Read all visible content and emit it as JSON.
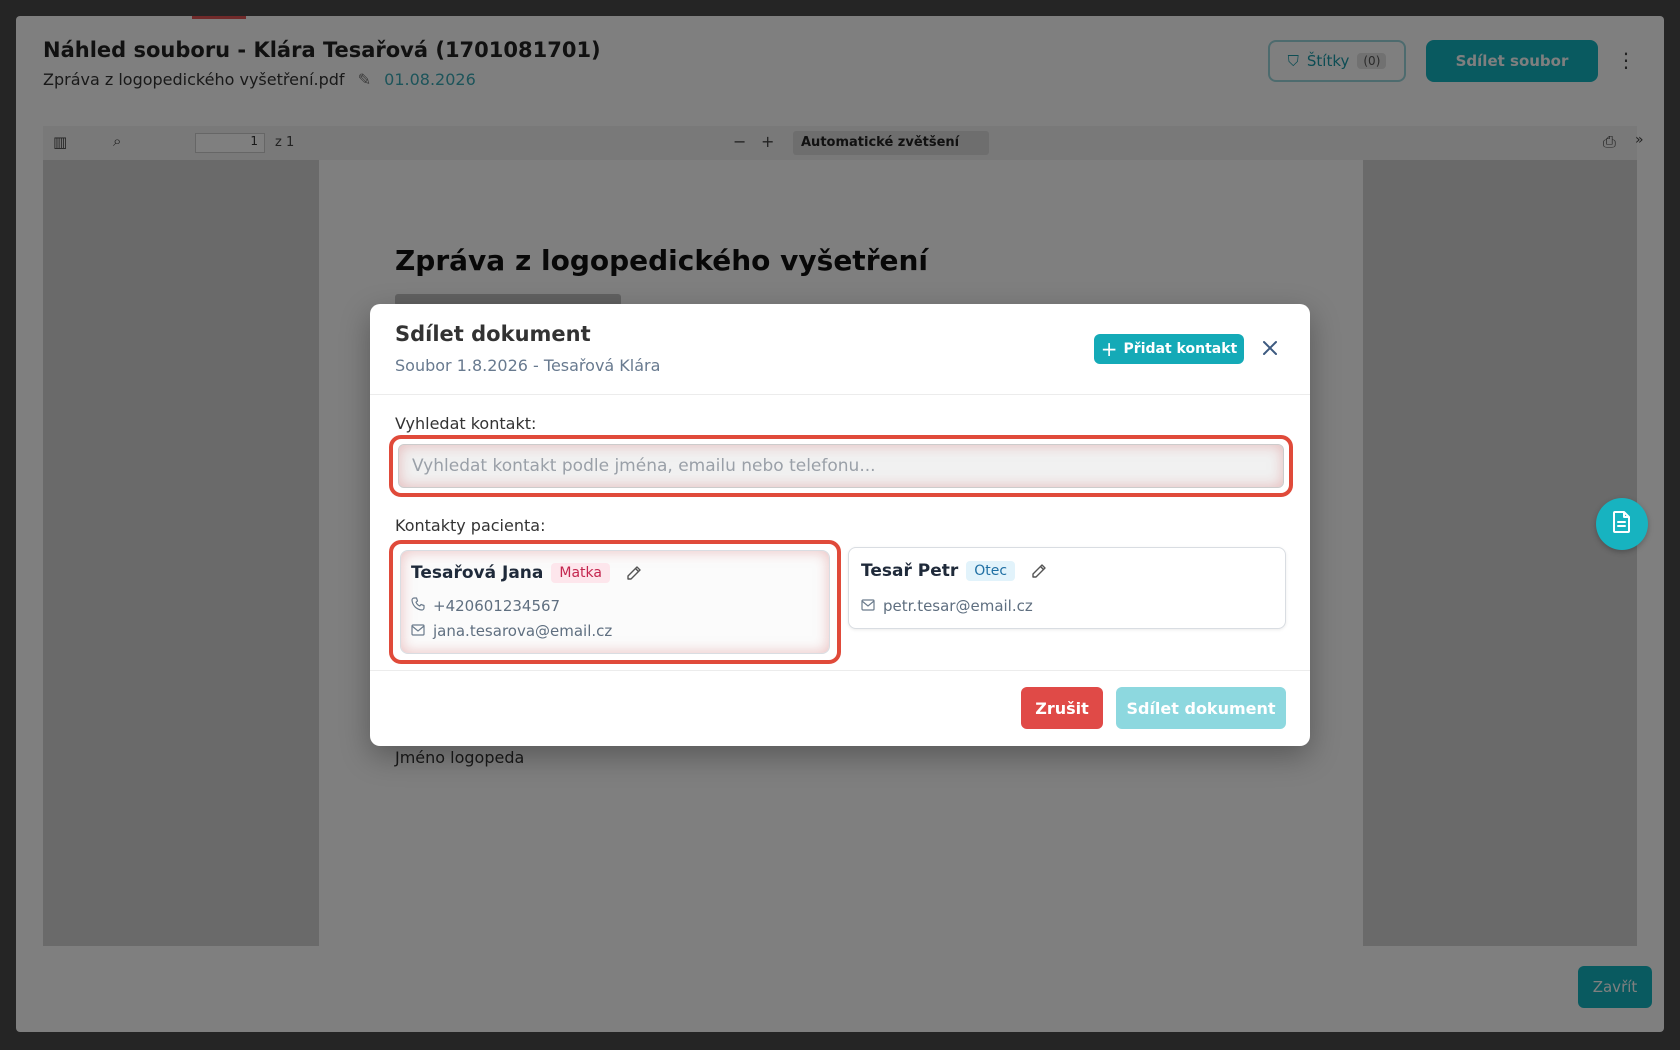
{
  "background": {
    "title": "Náhled souboru - Klára Tesařová (1701081701)",
    "file_name": "Zpráva z logopedického vyšetření.pdf",
    "date": "01.08.2026",
    "filter_label": "Štítky",
    "filter_count": "(0)",
    "share_button": "Sdílet soubor",
    "toolbar": {
      "page_value": "1",
      "pages_label": "z 1",
      "zoom_label": "Automatické zvětšení"
    },
    "document": {
      "heading": "Zpráva z logopedického vyšetření",
      "signature": "Jméno logopeda"
    },
    "close_button": "Zavřít"
  },
  "modal": {
    "title": "Sdílet dokument",
    "subtitle": "Soubor 1.8.2026 - Tesařová Klára",
    "add_contact_label": "Přidat kontakt",
    "search_label": "Vyhledat kontakt:",
    "search_placeholder": "Vyhledat kontakt podle jména, emailu nebo telefonu...",
    "contacts_label": "Kontakty pacienta:",
    "contacts": [
      {
        "name": "Tesařová Jana",
        "role": "Matka",
        "phone": "+420601234567",
        "email": "jana.tesarova@email.cz"
      },
      {
        "name": "Tesař Petr",
        "role": "Otec",
        "email": "petr.tesar@email.cz"
      }
    ],
    "cancel_label": "Zrušit",
    "share_label": "Sdílet dokument"
  },
  "icons": {
    "add": "plus-icon",
    "close": "close-icon",
    "edit": "pencil-icon",
    "phone": "phone-icon",
    "email": "mail-icon",
    "floating": "document-icon"
  },
  "colors": {
    "accent": "#14aab7",
    "danger": "#e04a47",
    "highlight": "#e04a3a",
    "badge_mother": "#c4264f",
    "badge_father": "#1f6fa3"
  }
}
